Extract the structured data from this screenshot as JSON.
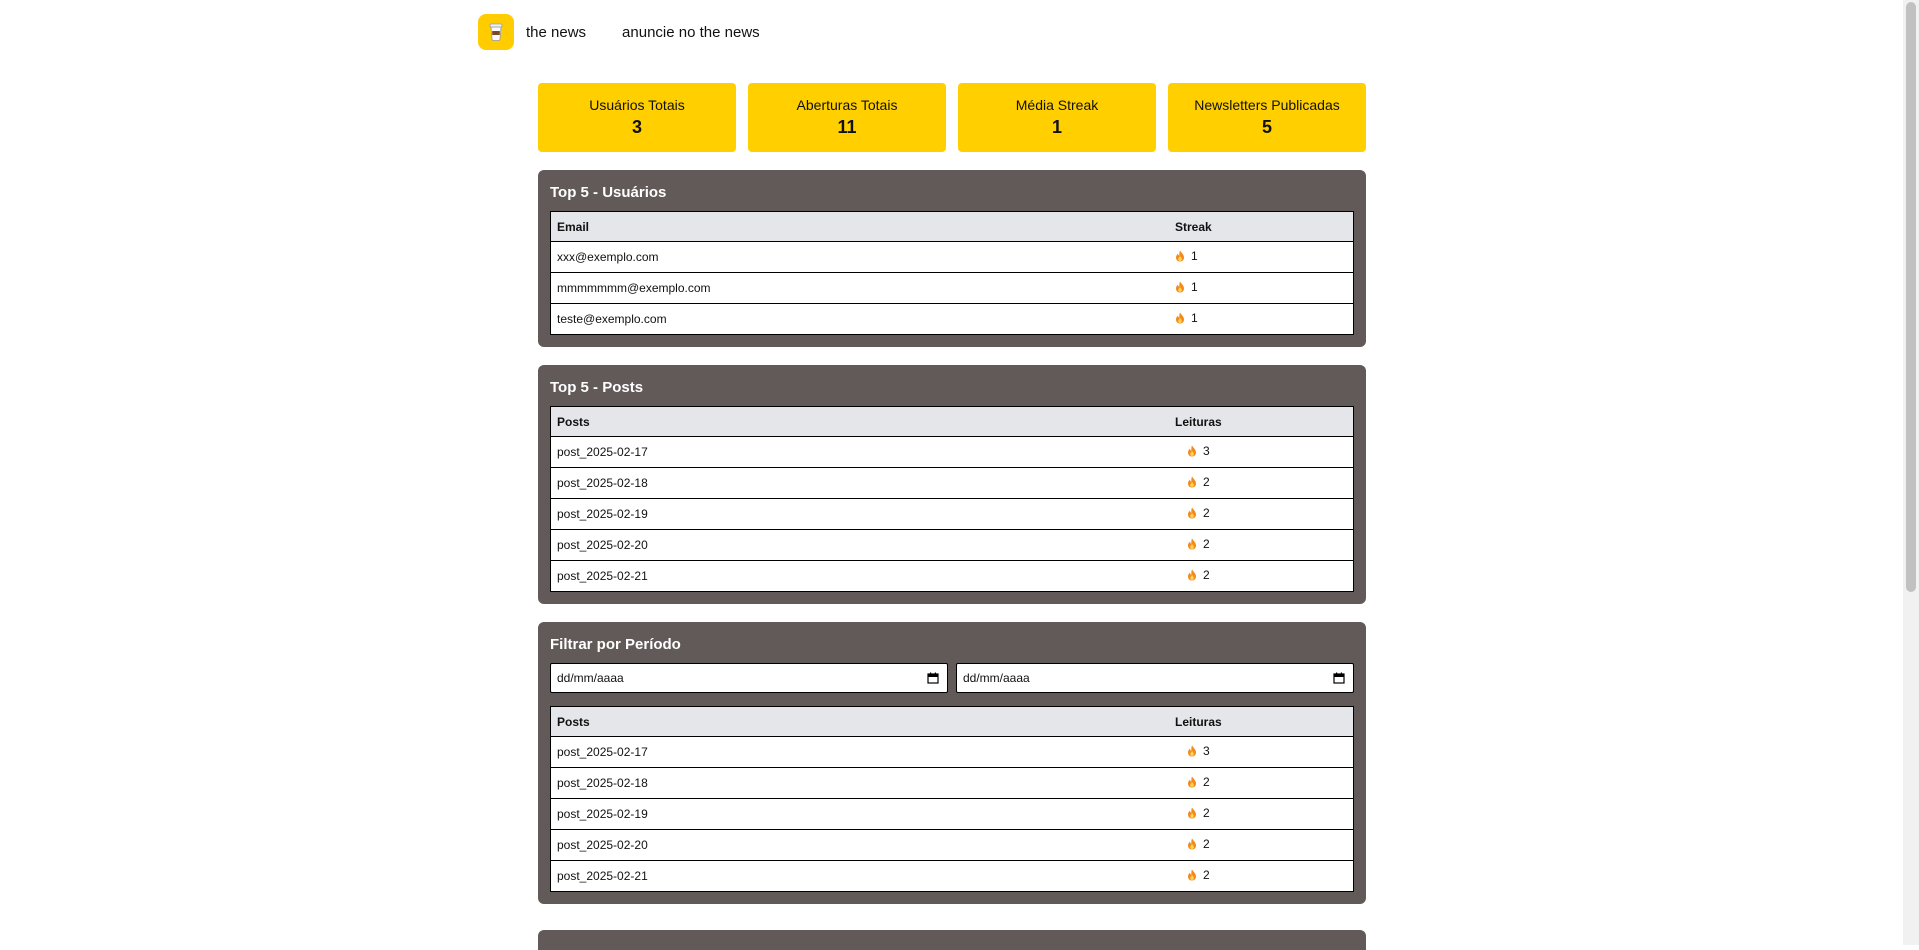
{
  "nav": {
    "brand_label": "the news",
    "advertise_label": "anuncie no the news",
    "logo_icon": "coffee-cup-icon"
  },
  "stats": [
    {
      "label": "Usuários Totais",
      "value": "3"
    },
    {
      "label": "Aberturas Totais",
      "value": "11"
    },
    {
      "label": "Média Streak",
      "value": "1"
    },
    {
      "label": "Newsletters Publicadas",
      "value": "5"
    }
  ],
  "top_users": {
    "title": "Top 5 - Usuários",
    "headers": [
      "Email",
      "Streak"
    ],
    "rows": [
      {
        "email": "xxx@exemplo.com",
        "streak": "1"
      },
      {
        "email": "mmmmmmm@exemplo.com",
        "streak": "1"
      },
      {
        "email": "teste@exemplo.com",
        "streak": "1"
      }
    ]
  },
  "top_posts": {
    "title": "Top 5 - Posts",
    "headers": [
      "Posts",
      "Leituras"
    ],
    "rows": [
      {
        "post": "post_2025-02-17",
        "reads": "3"
      },
      {
        "post": "post_2025-02-18",
        "reads": "2"
      },
      {
        "post": "post_2025-02-19",
        "reads": "2"
      },
      {
        "post": "post_2025-02-20",
        "reads": "2"
      },
      {
        "post": "post_2025-02-21",
        "reads": "2"
      }
    ]
  },
  "filter": {
    "title": "Filtrar por Período",
    "start_placeholder": "dd/mm/aaaa",
    "end_placeholder": "dd/mm/aaaa",
    "headers": [
      "Posts",
      "Leituras"
    ],
    "rows": [
      {
        "post": "post_2025-02-17",
        "reads": "3"
      },
      {
        "post": "post_2025-02-18",
        "reads": "2"
      },
      {
        "post": "post_2025-02-19",
        "reads": "2"
      },
      {
        "post": "post_2025-02-20",
        "reads": "2"
      },
      {
        "post": "post_2025-02-21",
        "reads": "2"
      }
    ]
  },
  "colors": {
    "accent_yellow": "#ffcf00",
    "panel_bg": "#625a59",
    "header_bg": "#e4e6ea"
  }
}
